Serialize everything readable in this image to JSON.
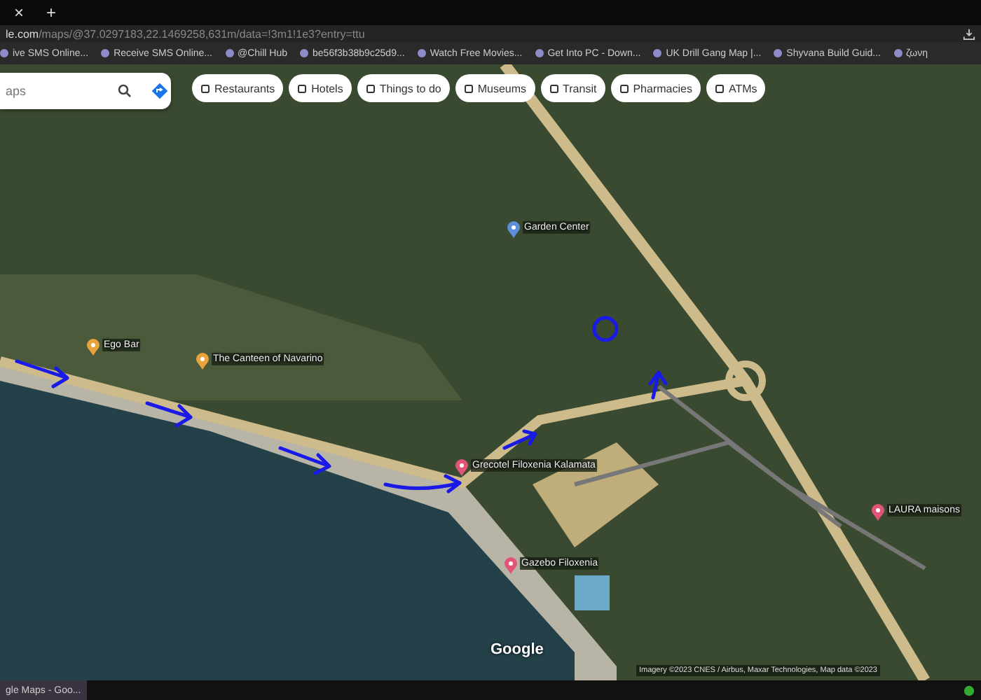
{
  "browser": {
    "tab_close": "×",
    "new_tab": "+",
    "url_host": "le.com",
    "url_path": "/maps/@37.0297183,22.1469258,631m/data=!3m1!1e3?entry=ttu"
  },
  "bookmarks": [
    {
      "label": "ive SMS Online..."
    },
    {
      "label": "Receive SMS Online..."
    },
    {
      "label": "@Chill Hub"
    },
    {
      "label": "be56f3b38b9c25d9..."
    },
    {
      "label": "Watch Free Movies..."
    },
    {
      "label": "Get Into PC - Down..."
    },
    {
      "label": "UK Drill Gang Map |..."
    },
    {
      "label": "Shyvana Build Guid..."
    },
    {
      "label": "ζωνη"
    }
  ],
  "search": {
    "placeholder": "aps"
  },
  "chips": [
    {
      "label": "Restaurants"
    },
    {
      "label": "Hotels"
    },
    {
      "label": "Things to do"
    },
    {
      "label": "Museums"
    },
    {
      "label": "Transit"
    },
    {
      "label": "Pharmacies"
    },
    {
      "label": "ATMs"
    }
  ],
  "places": [
    {
      "name": "Ego Bar",
      "kind": "food"
    },
    {
      "name": "The Canteen of Navarino",
      "kind": "food"
    },
    {
      "name": "Garden Center",
      "kind": "shop"
    },
    {
      "name": "Grecotel Filoxenia Kalamata",
      "kind": "hotel"
    },
    {
      "name": "Gazebo Filoxenia",
      "kind": "hotel"
    },
    {
      "name": "LAURA maisons",
      "kind": "hotel"
    }
  ],
  "map": {
    "logo": "Google",
    "attribution": "Imagery ©2023 CNES / Airbus, Maxar Technologies, Map data ©2023"
  },
  "taskbar": {
    "window": "gle Maps - Goo..."
  }
}
